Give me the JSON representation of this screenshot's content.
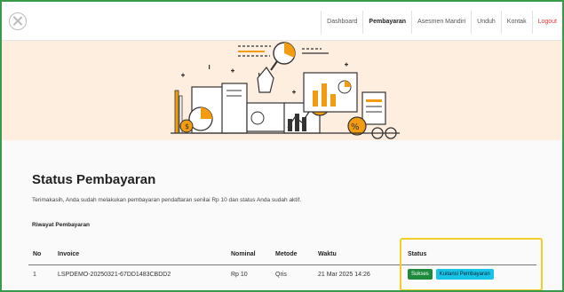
{
  "nav": {
    "items": [
      "Dashboard",
      "Pembayaran",
      "Asesmen Mandiri",
      "Unduh",
      "Kontak",
      "Logout"
    ]
  },
  "colors": {
    "hero_bg": "#fdeee0",
    "success": "#1e8a3c",
    "receipt_button": "#17c3e6",
    "logout": "#e53935",
    "highlight_box": "#f5cd2b",
    "frame_border": "#3a9a4c"
  },
  "icons": {
    "logo": "close-circle-icon"
  },
  "page": {
    "title": "Status Pembayaran",
    "description": "Terimakasih, Anda sudah melakukan pembayaran pendaftaran senilai Rp 10 dan status Anda sudah aktif.",
    "history_label": "Riwayat Pembayaran"
  },
  "table": {
    "headers": [
      "No",
      "Invoice",
      "Nominal",
      "Metode",
      "Waktu",
      "Status"
    ],
    "rows": [
      {
        "no": "1",
        "invoice": "LSPDEMO-20250321-67DD1483CBDD2",
        "nominal": "Rp 10",
        "method": "Qris",
        "time": "21 Mar 2025 14:26",
        "status": "Sukses",
        "action": "Kuitansi Pembayaran"
      }
    ]
  }
}
